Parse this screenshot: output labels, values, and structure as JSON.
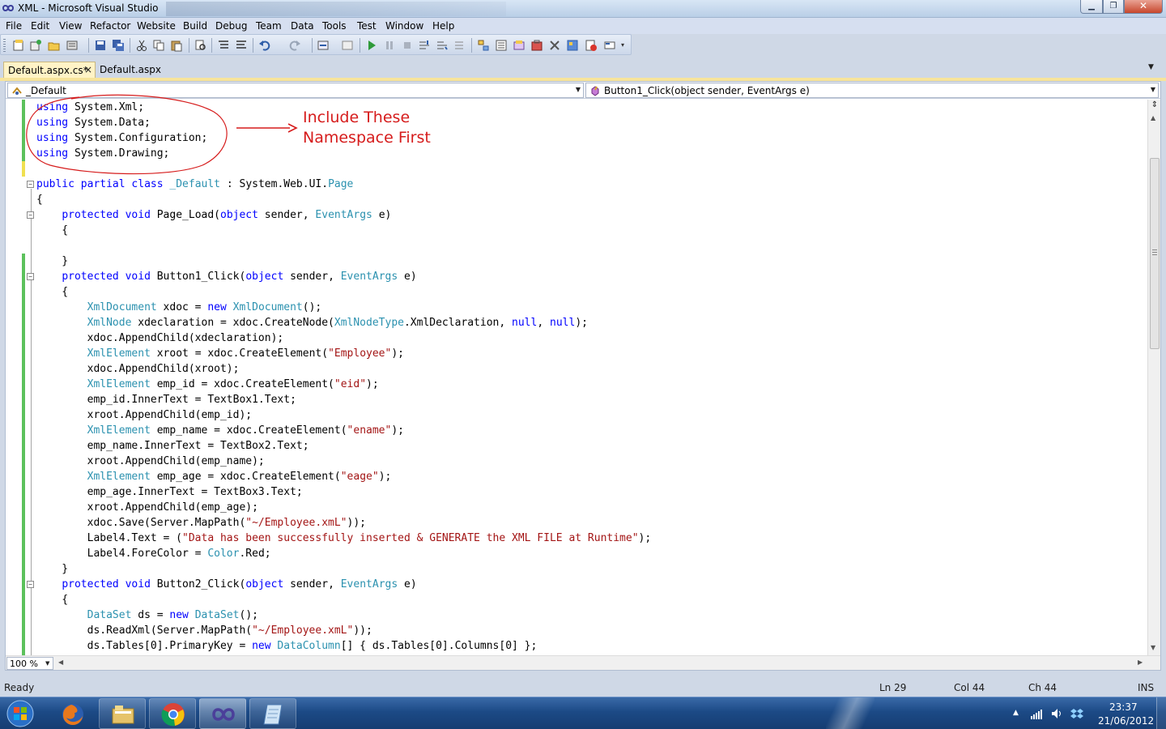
{
  "window": {
    "title": "XML - Microsoft Visual Studio",
    "icon": "visual-studio-infinity-icon",
    "controls": {
      "minimize": "minimize-icon",
      "maximize": "maximize-icon",
      "close": "close-icon"
    }
  },
  "menu": {
    "items": [
      "File",
      "Edit",
      "View",
      "Refactor",
      "Website",
      "Build",
      "Debug",
      "Team",
      "Data",
      "Tools",
      "Test",
      "Window",
      "Help"
    ]
  },
  "toolbar": {
    "icons": [
      "new-project-icon",
      "add-item-icon",
      "open-file-icon",
      "add-new-icon",
      "save-icon",
      "save-all-icon",
      "cut-icon",
      "copy-icon",
      "paste-icon",
      "find-icon",
      "comment-icon",
      "uncomment-icon",
      "undo-icon",
      "redo-icon",
      "navigate-icon",
      "start-debugging-icon",
      "break-all-icon",
      "stop-icon",
      "step-into-icon",
      "step-over-icon",
      "step-out-icon",
      "solution-explorer-icon",
      "properties-icon",
      "object-browser-icon",
      "toolbox-icon",
      "extension-manager-icon",
      "start-page-icon",
      "options-icon"
    ]
  },
  "tabs": {
    "active": {
      "label": "Default.aspx.cs*",
      "close": "×"
    },
    "inactive": {
      "label": "Default.aspx"
    },
    "dropdown": "▼"
  },
  "navigation": {
    "class_combo": "_Default",
    "member_combo": "Button1_Click(object sender, EventArgs e)"
  },
  "code": {
    "lines": [
      [
        {
          "t": "using",
          "c": "kw"
        },
        {
          "t": " System.Xml;"
        }
      ],
      [
        {
          "t": "using",
          "c": "kw"
        },
        {
          "t": " System.Data;"
        }
      ],
      [
        {
          "t": "using",
          "c": "kw"
        },
        {
          "t": " System.Configuration;"
        }
      ],
      [
        {
          "t": "using",
          "c": "kw"
        },
        {
          "t": " System.Drawing;"
        }
      ],
      [
        {
          "t": ""
        }
      ],
      [
        {
          "t": "public",
          "c": "kw"
        },
        {
          "t": " "
        },
        {
          "t": "partial",
          "c": "kw"
        },
        {
          "t": " "
        },
        {
          "t": "class",
          "c": "kw"
        },
        {
          "t": " "
        },
        {
          "t": "_Default",
          "c": "ty"
        },
        {
          "t": " : System.Web.UI."
        },
        {
          "t": "Page",
          "c": "ty"
        }
      ],
      [
        {
          "t": "{"
        }
      ],
      [
        {
          "t": "    "
        },
        {
          "t": "protected",
          "c": "kw"
        },
        {
          "t": " "
        },
        {
          "t": "void",
          "c": "kw"
        },
        {
          "t": " Page_Load("
        },
        {
          "t": "object",
          "c": "kw"
        },
        {
          "t": " sender, "
        },
        {
          "t": "EventArgs",
          "c": "ty"
        },
        {
          "t": " e)"
        }
      ],
      [
        {
          "t": "    {"
        }
      ],
      [
        {
          "t": ""
        }
      ],
      [
        {
          "t": "    }"
        }
      ],
      [
        {
          "t": "    "
        },
        {
          "t": "protected",
          "c": "kw"
        },
        {
          "t": " "
        },
        {
          "t": "void",
          "c": "kw"
        },
        {
          "t": " Button1_Click("
        },
        {
          "t": "object",
          "c": "kw"
        },
        {
          "t": " sender, "
        },
        {
          "t": "EventArgs",
          "c": "ty"
        },
        {
          "t": " e)"
        }
      ],
      [
        {
          "t": "    {"
        }
      ],
      [
        {
          "t": "        "
        },
        {
          "t": "XmlDocument",
          "c": "ty"
        },
        {
          "t": " xdoc = "
        },
        {
          "t": "new",
          "c": "kw"
        },
        {
          "t": " "
        },
        {
          "t": "XmlDocument",
          "c": "ty"
        },
        {
          "t": "();"
        }
      ],
      [
        {
          "t": "        "
        },
        {
          "t": "XmlNode",
          "c": "ty"
        },
        {
          "t": " xdeclaration = xdoc.CreateNode("
        },
        {
          "t": "XmlNodeType",
          "c": "ty"
        },
        {
          "t": ".XmlDeclaration, "
        },
        {
          "t": "null",
          "c": "kw"
        },
        {
          "t": ", "
        },
        {
          "t": "null",
          "c": "kw"
        },
        {
          "t": ");"
        }
      ],
      [
        {
          "t": "        xdoc.AppendChild(xdeclaration);"
        }
      ],
      [
        {
          "t": "        "
        },
        {
          "t": "XmlElement",
          "c": "ty"
        },
        {
          "t": " xroot = xdoc.CreateElement("
        },
        {
          "t": "\"Employee\"",
          "c": "st"
        },
        {
          "t": ");"
        }
      ],
      [
        {
          "t": "        xdoc.AppendChild(xroot);"
        }
      ],
      [
        {
          "t": "        "
        },
        {
          "t": "XmlElement",
          "c": "ty"
        },
        {
          "t": " emp_id = xdoc.CreateElement("
        },
        {
          "t": "\"eid\"",
          "c": "st"
        },
        {
          "t": ");"
        }
      ],
      [
        {
          "t": "        emp_id.InnerText = TextBox1.Text;"
        }
      ],
      [
        {
          "t": "        xroot.AppendChild(emp_id);"
        }
      ],
      [
        {
          "t": "        "
        },
        {
          "t": "XmlElement",
          "c": "ty"
        },
        {
          "t": " emp_name = xdoc.CreateElement("
        },
        {
          "t": "\"ename\"",
          "c": "st"
        },
        {
          "t": ");"
        }
      ],
      [
        {
          "t": "        emp_name.InnerText = TextBox2.Text;"
        }
      ],
      [
        {
          "t": "        xroot.AppendChild(emp_name);"
        }
      ],
      [
        {
          "t": "        "
        },
        {
          "t": "XmlElement",
          "c": "ty"
        },
        {
          "t": " emp_age = xdoc.CreateElement("
        },
        {
          "t": "\"eage\"",
          "c": "st"
        },
        {
          "t": ");"
        }
      ],
      [
        {
          "t": "        emp_age.InnerText = TextBox3.Text;"
        }
      ],
      [
        {
          "t": "        xroot.AppendChild(emp_age);"
        }
      ],
      [
        {
          "t": "        xdoc.Save(Server.MapPath("
        },
        {
          "t": "\"~/Employee.xmL\"",
          "c": "st"
        },
        {
          "t": "));"
        }
      ],
      [
        {
          "t": "        Label4.Text = ("
        },
        {
          "t": "\"Data has been successfully inserted & GENERATE the XML FILE at Runtime\"",
          "c": "st"
        },
        {
          "t": ");"
        }
      ],
      [
        {
          "t": "        Label4.ForeColor = "
        },
        {
          "t": "Color",
          "c": "ty"
        },
        {
          "t": ".Red;"
        }
      ],
      [
        {
          "t": "    }"
        }
      ],
      [
        {
          "t": "    "
        },
        {
          "t": "protected",
          "c": "kw"
        },
        {
          "t": " "
        },
        {
          "t": "void",
          "c": "kw"
        },
        {
          "t": " Button2_Click("
        },
        {
          "t": "object",
          "c": "kw"
        },
        {
          "t": " sender, "
        },
        {
          "t": "EventArgs",
          "c": "ty"
        },
        {
          "t": " e)"
        }
      ],
      [
        {
          "t": "    {"
        }
      ],
      [
        {
          "t": "        "
        },
        {
          "t": "DataSet",
          "c": "ty"
        },
        {
          "t": " ds = "
        },
        {
          "t": "new",
          "c": "kw"
        },
        {
          "t": " "
        },
        {
          "t": "DataSet",
          "c": "ty"
        },
        {
          "t": "();"
        }
      ],
      [
        {
          "t": "        ds.ReadXml(Server.MapPath("
        },
        {
          "t": "\"~/Employee.xmL\"",
          "c": "st"
        },
        {
          "t": "));"
        }
      ],
      [
        {
          "t": "        ds.Tables[0].PrimaryKey = "
        },
        {
          "t": "new",
          "c": "kw"
        },
        {
          "t": " "
        },
        {
          "t": "DataColumn",
          "c": "ty"
        },
        {
          "t": "[] { ds.Tables[0].Columns[0] };"
        }
      ]
    ]
  },
  "annotation": {
    "line1": "Include These",
    "line2": "Namespace First",
    "color": "#d61c1c"
  },
  "editor": {
    "zoom": "100 %",
    "split_icon": "split-window-icon"
  },
  "status": {
    "ready": "Ready",
    "line": "Ln 29",
    "col": "Col 44",
    "ch": "Ch 44",
    "mode": "INS"
  },
  "taskbar": {
    "apps": [
      "firefox-icon",
      "windows-explorer-icon",
      "chrome-icon",
      "visual-studio-icon",
      "notepad-icon"
    ],
    "tray": [
      "show-hidden-icons",
      "network-signal-icon",
      "volume-icon",
      "dropbox-icon"
    ],
    "tray_up": "▲",
    "time": "23:37",
    "date": "21/06/2012"
  },
  "colors": {
    "keyword": "#0000ff",
    "type": "#2b91af",
    "string": "#a31515",
    "tab_active": "#fff3c6",
    "change_saved": "#5cc15c",
    "change_unsaved": "#f0e050"
  }
}
